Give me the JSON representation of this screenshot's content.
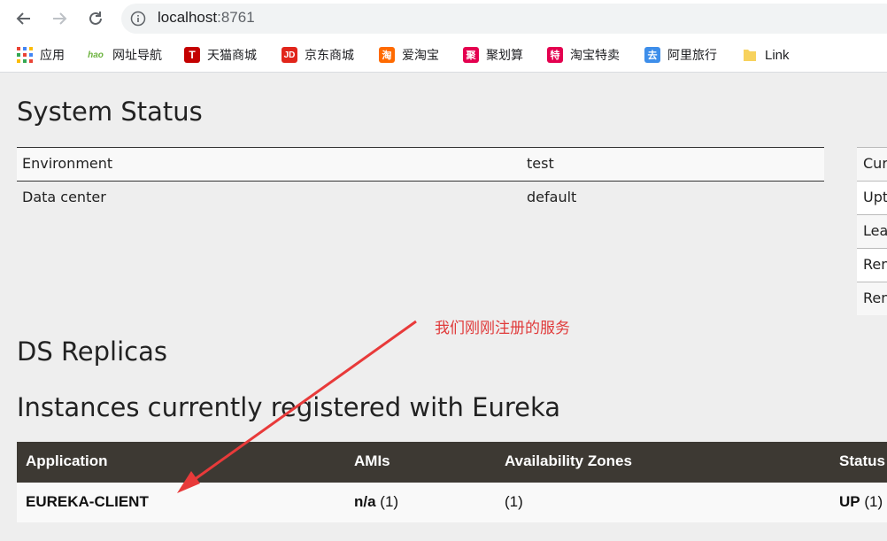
{
  "browser": {
    "url_host": "localhost",
    "url_port": ":8761"
  },
  "bookmarks": [
    {
      "label": "应用",
      "icon": "apps-grid-icon"
    },
    {
      "label": "网址导航",
      "icon": "hao123-icon",
      "glyph": "hao",
      "color": "#6cb33f"
    },
    {
      "label": "天猫商城",
      "icon": "tmall-icon",
      "glyph": "T",
      "color": "#c40000"
    },
    {
      "label": "京东商城",
      "icon": "jd-icon",
      "glyph": "JD",
      "color": "#e1251b"
    },
    {
      "label": "爱淘宝",
      "icon": "aitaobao-icon",
      "glyph": "淘",
      "color": "#ff6a00"
    },
    {
      "label": "聚划算",
      "icon": "juhuasuan-icon",
      "glyph": "聚",
      "color": "#e4004f"
    },
    {
      "label": "淘宝特卖",
      "icon": "taobao-temai-icon",
      "glyph": "特",
      "color": "#e4004f"
    },
    {
      "label": "阿里旅行",
      "icon": "ali-travel-icon",
      "glyph": "去",
      "color": "#3d8eea"
    },
    {
      "label": "Link",
      "icon": "folder-icon",
      "color": "#f7d25d"
    }
  ],
  "system_status": {
    "title": "System Status",
    "rows": [
      {
        "label": "Environment",
        "value": "test"
      },
      {
        "label": "Data center",
        "value": "default"
      }
    ],
    "side_rows": [
      "Cur",
      "Upt",
      "Lea",
      "Ren",
      "Ren"
    ]
  },
  "replicas": {
    "title": "DS Replicas"
  },
  "annotation": "我们刚刚注册的服务",
  "instances": {
    "title": "Instances currently registered with Eureka",
    "headers": [
      "Application",
      "AMIs",
      "Availability Zones",
      "Status"
    ],
    "rows": [
      {
        "application": "EUREKA-CLIENT",
        "amis_bold": "n/a",
        "amis_count": " (1)",
        "zones": "(1)",
        "status_bold": "UP",
        "status_count": " (1)"
      }
    ]
  },
  "colors": {
    "table_header_bg": "#3d3933",
    "annotation": "#e03a3a"
  }
}
